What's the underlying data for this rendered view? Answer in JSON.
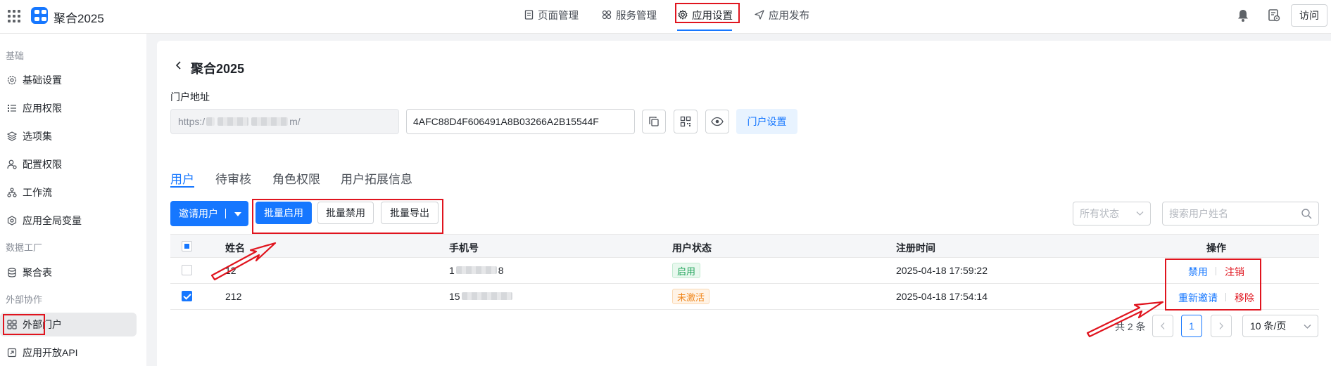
{
  "header": {
    "app_name": "聚合2025",
    "nav": [
      {
        "label": "页面管理",
        "icon": "document-icon"
      },
      {
        "label": "服务管理",
        "icon": "services-icon"
      },
      {
        "label": "应用设置",
        "icon": "gear-icon",
        "active": true
      },
      {
        "label": "应用发布",
        "icon": "send-icon"
      }
    ],
    "visit_label": "访问"
  },
  "sidebar": {
    "groups": [
      {
        "title": "基础",
        "items": [
          "基础设置",
          "应用权限",
          "选项集",
          "配置权限",
          "工作流",
          "应用全局变量"
        ]
      },
      {
        "title": "数据工厂",
        "items": [
          "聚合表"
        ]
      },
      {
        "title": "外部协作",
        "items": [
          "外部门户",
          "应用开放API"
        ]
      }
    ],
    "active_item": "外部门户"
  },
  "page": {
    "title": "聚合2025",
    "portal_address_label": "门户地址",
    "portal_url_prefix": "https:/",
    "portal_url_suffix": "m/",
    "portal_key": "4AFC88D4F606491A8B03266A2B15544F",
    "portal_settings_label": "门户设置"
  },
  "tabs": [
    "用户",
    "待审核",
    "角色权限",
    "用户拓展信息"
  ],
  "toolbar": {
    "invite_label": "邀请用户",
    "batch_enable": "批量启用",
    "batch_disable": "批量禁用",
    "batch_export": "批量导出",
    "status_placeholder": "所有状态",
    "search_placeholder": "搜索用户姓名"
  },
  "table": {
    "columns": [
      "姓名",
      "手机号",
      "用户状态",
      "注册时间",
      "操作"
    ],
    "rows": [
      {
        "checked": false,
        "name": "12",
        "phone_prefix": "1",
        "phone_suffix": "8",
        "status": "启用",
        "registered": "2025-04-18 17:59:22",
        "actions": [
          "禁用",
          "注销"
        ]
      },
      {
        "checked": true,
        "name": "212",
        "phone_prefix": "15",
        "phone_suffix": "",
        "status": "未激活",
        "registered": "2025-04-18 17:54:14",
        "actions": [
          "重新邀请",
          "移除"
        ]
      }
    ]
  },
  "pagination": {
    "total_text": "共 2 条",
    "current_page": "1",
    "page_size": "10 条/页"
  },
  "colors": {
    "accent": "#1677ff",
    "annotation": "#e0141e",
    "status_enabled": "#1fa35a",
    "status_inactive": "#f0861a"
  }
}
